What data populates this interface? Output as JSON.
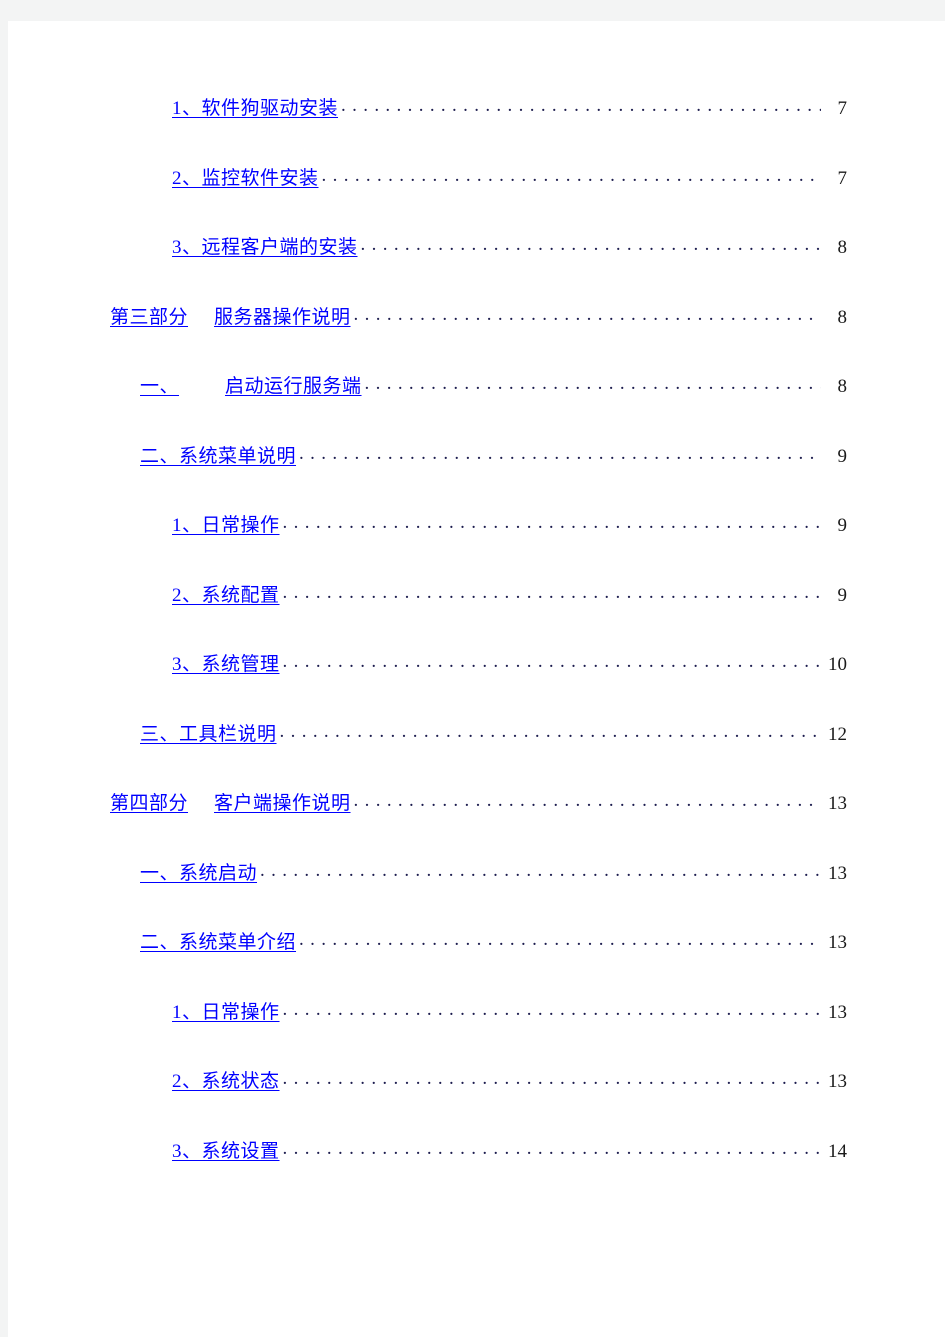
{
  "document": {
    "type": "table-of-contents",
    "colors": {
      "link": "#0000ff",
      "leader": "#1b1b4d",
      "page_number": "#1a1a1a",
      "page_background": "#ffffff",
      "canvas_background": "#f3f4f4"
    }
  },
  "toc": {
    "entries": [
      {
        "label": "1、软件狗驱动安装",
        "page": "7",
        "level": 3
      },
      {
        "label": "2、监控软件安装",
        "page": "7",
        "level": 3
      },
      {
        "label": "3、远程客户端的安装",
        "page": "8",
        "level": 3
      },
      {
        "label": "第三部分  服务器操作说明",
        "page": "8",
        "level": 1,
        "prefix": "第三部分",
        "suffix": "服务器操作说明"
      },
      {
        "label": "一、  启动运行服务端",
        "page": "8",
        "level": 2,
        "prefix": "一、",
        "suffix": "启动运行服务端"
      },
      {
        "label": "二、系统菜单说明",
        "page": "9",
        "level": 2
      },
      {
        "label": "1、日常操作",
        "page": "9",
        "level": 3
      },
      {
        "label": "2、系统配置",
        "page": "9",
        "level": 3
      },
      {
        "label": "3、系统管理",
        "page": "10",
        "level": 3
      },
      {
        "label": "三、工具栏说明",
        "page": "12",
        "level": 2
      },
      {
        "label": "第四部分  客户端操作说明",
        "page": "13",
        "level": 1,
        "prefix": "第四部分",
        "suffix": "客户端操作说明"
      },
      {
        "label": "一、系统启动",
        "page": "13",
        "level": 2
      },
      {
        "label": "二、系统菜单介绍",
        "page": "13",
        "level": 2
      },
      {
        "label": "1、日常操作",
        "page": "13",
        "level": 3
      },
      {
        "label": "2、系统状态",
        "page": "13",
        "level": 3
      },
      {
        "label": "3、系统设置",
        "page": "14",
        "level": 3
      }
    ]
  }
}
